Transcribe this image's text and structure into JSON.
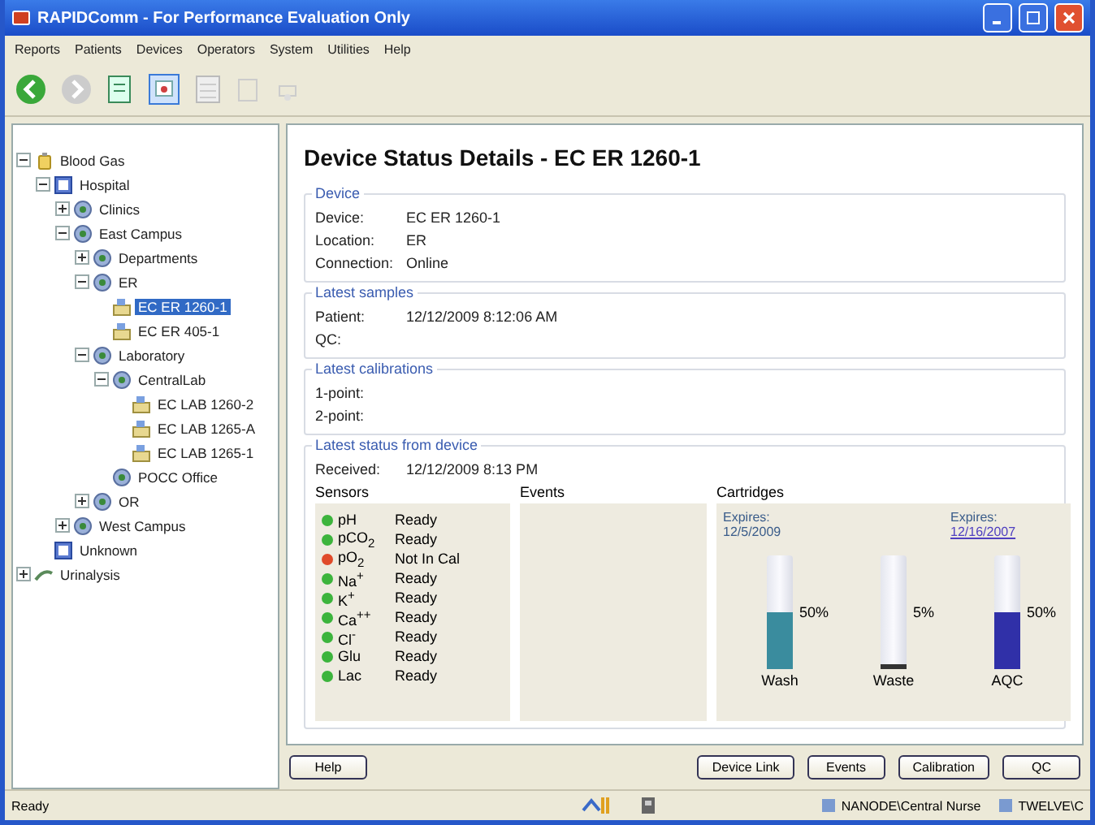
{
  "window": {
    "title": "RAPIDComm - For Performance Evaluation Only"
  },
  "menu": [
    "Reports",
    "Patients",
    "Devices",
    "Operators",
    "System",
    "Utilities",
    "Help"
  ],
  "tree": [
    {
      "label": "Blood Gas",
      "kind": "root",
      "expanded": true,
      "selected": false,
      "children": [
        {
          "label": "Hospital",
          "kind": "site",
          "expanded": true,
          "selected": false,
          "children": [
            {
              "label": "Clinics",
              "kind": "group",
              "expanded": false,
              "selected": false
            },
            {
              "label": "East Campus",
              "kind": "group",
              "expanded": true,
              "selected": false,
              "children": [
                {
                  "label": "Departments",
                  "kind": "group",
                  "expanded": false,
                  "selected": false
                },
                {
                  "label": "ER",
                  "kind": "group",
                  "expanded": true,
                  "selected": false,
                  "children": [
                    {
                      "label": "EC ER 1260-1",
                      "kind": "device",
                      "selected": true
                    },
                    {
                      "label": "EC ER 405-1",
                      "kind": "device",
                      "selected": false
                    }
                  ]
                },
                {
                  "label": "Laboratory",
                  "kind": "group",
                  "expanded": true,
                  "selected": false,
                  "children": [
                    {
                      "label": "CentralLab",
                      "kind": "group",
                      "expanded": true,
                      "selected": false,
                      "children": [
                        {
                          "label": "EC LAB 1260-2",
                          "kind": "device",
                          "selected": false
                        },
                        {
                          "label": "EC LAB 1265-A",
                          "kind": "device",
                          "selected": false
                        },
                        {
                          "label": "EC LAB 1265-1",
                          "kind": "device",
                          "selected": false
                        }
                      ]
                    },
                    {
                      "label": "POCC Office",
                      "kind": "group",
                      "selected": false
                    }
                  ]
                },
                {
                  "label": "OR",
                  "kind": "group",
                  "expanded": false,
                  "selected": false
                }
              ]
            },
            {
              "label": "West Campus",
              "kind": "group",
              "expanded": false,
              "selected": false
            }
          ]
        },
        {
          "label": "Unknown",
          "kind": "site",
          "selected": false
        }
      ]
    },
    {
      "label": "Urinalysis",
      "kind": "urine",
      "expanded": false,
      "selected": false
    }
  ],
  "heading": "Device Status Details - EC ER 1260-1",
  "groups": [
    {
      "title": "Device",
      "rows": [
        {
          "label": "Device:",
          "value": "EC ER 1260-1"
        },
        {
          "label": "Location:",
          "value": "ER"
        },
        {
          "label": "Connection:",
          "value": "Online"
        }
      ]
    },
    {
      "title": "Latest samples",
      "rows": [
        {
          "label": "Patient:",
          "value": "12/12/2009 8:12:06 AM"
        },
        {
          "label": "QC:"
        }
      ]
    },
    {
      "title": "Latest calibrations",
      "rows": [
        {
          "label": "1-point:"
        },
        {
          "label": "2-point:"
        }
      ]
    }
  ],
  "status": {
    "title": "Latest status from device",
    "received_label": "Received:",
    "received": "12/12/2009 8:13 PM",
    "sensors_label": "Sensors",
    "events_label": "Events",
    "cartridges_label": "Cartridges",
    "sensors": [
      {
        "name": "pH",
        "state": "Ready",
        "color": "#3cb43c"
      },
      {
        "name": "pCO$_{2}$",
        "state": "Ready",
        "color": "#3cb43c"
      },
      {
        "name": "pO$_{2}$",
        "state": "Not In Cal",
        "color": "#e04a2a"
      },
      {
        "name": "Na$^{+}$",
        "state": "Ready",
        "color": "#3cb43c"
      },
      {
        "name": "K$^{+}$",
        "state": "Ready",
        "color": "#3cb43c"
      },
      {
        "name": "Ca$^{++}$",
        "state": "Ready",
        "color": "#3cb43c"
      },
      {
        "name": "Cl$^{-}$",
        "state": "Ready",
        "color": "#3cb43c"
      },
      {
        "name": "Glu",
        "state": "Ready",
        "color": "#3cb43c"
      },
      {
        "name": "Lac",
        "state": "Ready",
        "color": "#3cb43c"
      }
    ],
    "cartridges": [
      {
        "name": "Wash",
        "level": 0.5,
        "reading": "50%",
        "color": "#3a8c9e",
        "expires_label": "Expires:",
        "expires": "12/5/2009",
        "expired": false
      },
      {
        "name": "Waste",
        "level": 0.05,
        "reading": "5%",
        "color": "#333333"
      },
      {
        "name": "AQC",
        "level": 0.5,
        "reading": "50%",
        "color": "#3030a8",
        "expires_label": "Expires:",
        "expires": "12/16/2007",
        "expired": true
      }
    ]
  },
  "buttons": {
    "left": [
      "Help"
    ],
    "right": [
      "Device Link",
      "Events",
      "Calibration",
      "QC"
    ]
  },
  "status_bar": {
    "text": "Ready",
    "panes": [
      "NANODE\\Central Nurse",
      "TWELVE\\C"
    ]
  }
}
